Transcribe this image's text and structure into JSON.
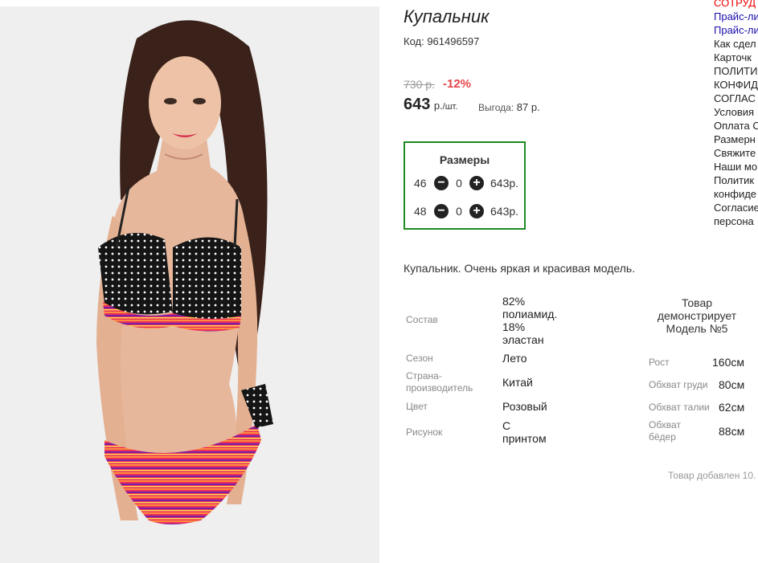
{
  "product": {
    "title": "Купальник",
    "code": "Код: 961496597",
    "old_price": "730 р.",
    "discount": "-12%",
    "price": "643",
    "price_unit": "р.",
    "price_unit_suffix": "/шт.",
    "benefit_label": "Выгода:",
    "benefit_value": "87 р.",
    "description": "Купальник. Очень яркая и красивая модель.",
    "added": "Товар добавлен 10."
  },
  "sizes": {
    "title": "Размеры",
    "rows": [
      {
        "size": "46",
        "qty": "0",
        "price": "643р."
      },
      {
        "size": "48",
        "qty": "0",
        "price": "643р."
      }
    ],
    "minus_icon": "minus-circle-icon",
    "plus_icon": "plus-circle-icon"
  },
  "attributes": [
    {
      "label": "Состав",
      "value": [
        "82%",
        "полиамид.",
        "18%",
        "эластан"
      ]
    },
    {
      "label": "Сезон",
      "value": [
        "Лето"
      ]
    },
    {
      "label": [
        "Страна-",
        "производитель"
      ],
      "value": [
        "Китай"
      ]
    },
    {
      "label": "Цвет",
      "value": [
        "Розовый"
      ]
    },
    {
      "label": "Рисунок",
      "value": [
        "С",
        "принтом"
      ]
    }
  ],
  "model": {
    "heading": [
      "Товар",
      "демонстрирует",
      "Модель №5"
    ],
    "params": [
      {
        "label": "Рост",
        "value": "160см"
      },
      {
        "label": "Обхват груди",
        "value": "80см"
      },
      {
        "label": "Обхват талии",
        "value": "62см"
      },
      {
        "label": [
          "Обхват",
          "бёдер"
        ],
        "value": "88см"
      }
    ]
  },
  "right_links": [
    {
      "text": "СОТРУД",
      "color": "#e00000"
    },
    {
      "text": "Прайс-ли",
      "color": "#1a0dab"
    },
    {
      "text": "Прайс-ли",
      "color": "#1a0dab"
    },
    {
      "text": "Как сдел"
    },
    {
      "text": "Карточк"
    },
    {
      "text": "ПОЛИТИ"
    },
    {
      "text": "КОНФИД"
    },
    {
      "text": "СОГЛАС"
    },
    {
      "text": "Условия"
    },
    {
      "text": "Оплата С"
    },
    {
      "text": "Размерн"
    },
    {
      "text": "Свяжите"
    },
    {
      "text": "Наши мо"
    },
    {
      "text": "Политик"
    },
    {
      "text": "конфиде"
    },
    {
      "text": "Согласие"
    },
    {
      "text": "персона"
    }
  ]
}
